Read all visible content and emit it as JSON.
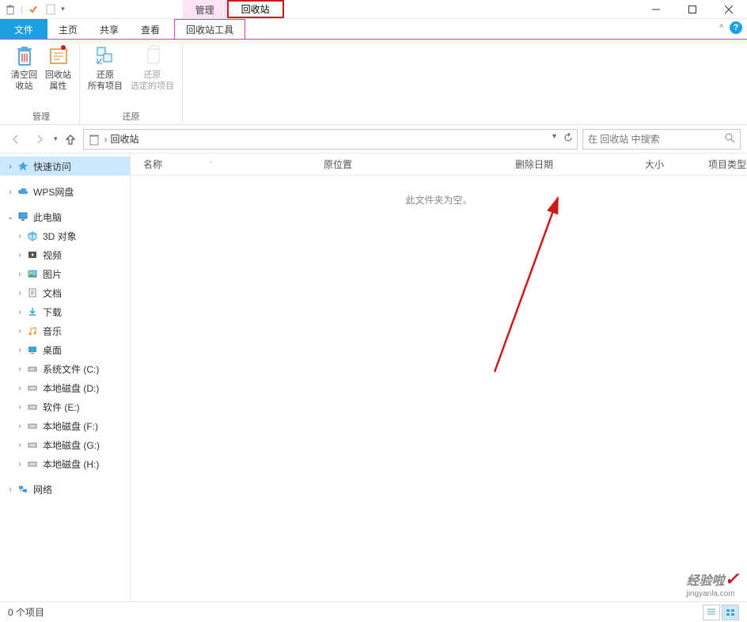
{
  "titlebar": {
    "tab_manage": "管理",
    "tab_recycle": "回收站"
  },
  "tabs": {
    "file": "文件",
    "home": "主页",
    "share": "共享",
    "view": "查看",
    "tools": "回收站工具"
  },
  "ribbon": {
    "group_manage": "管理",
    "group_restore": "还原",
    "empty_recycle": "清空回\n收站",
    "recycle_props": "回收站\n属性",
    "restore_all": "还原\n所有项目",
    "restore_selected": "还原\n选定的项目"
  },
  "nav": {
    "breadcrumb": "回收站"
  },
  "search": {
    "placeholder": "在 回收站 中搜索"
  },
  "columns": {
    "name": "名称",
    "original_location": "原位置",
    "date_deleted": "删除日期",
    "size": "大小",
    "item_type": "项目类型"
  },
  "content": {
    "empty": "此文件夹为空。"
  },
  "sidebar": {
    "quick_access": "快速访问",
    "wps_cloud": "WPS网盘",
    "this_pc": "此电脑",
    "network": "网络",
    "pc_items": [
      "3D 对象",
      "视频",
      "图片",
      "文档",
      "下载",
      "音乐",
      "桌面",
      "系统文件 (C:)",
      "本地磁盘 (D:)",
      "软件 (E:)",
      "本地磁盘 (F:)",
      "本地磁盘 (G:)",
      "本地磁盘 (H:)"
    ]
  },
  "statusbar": {
    "items": "0 个项目"
  },
  "watermark": {
    "text": "经验啦",
    "url": "jingyanla.com"
  }
}
